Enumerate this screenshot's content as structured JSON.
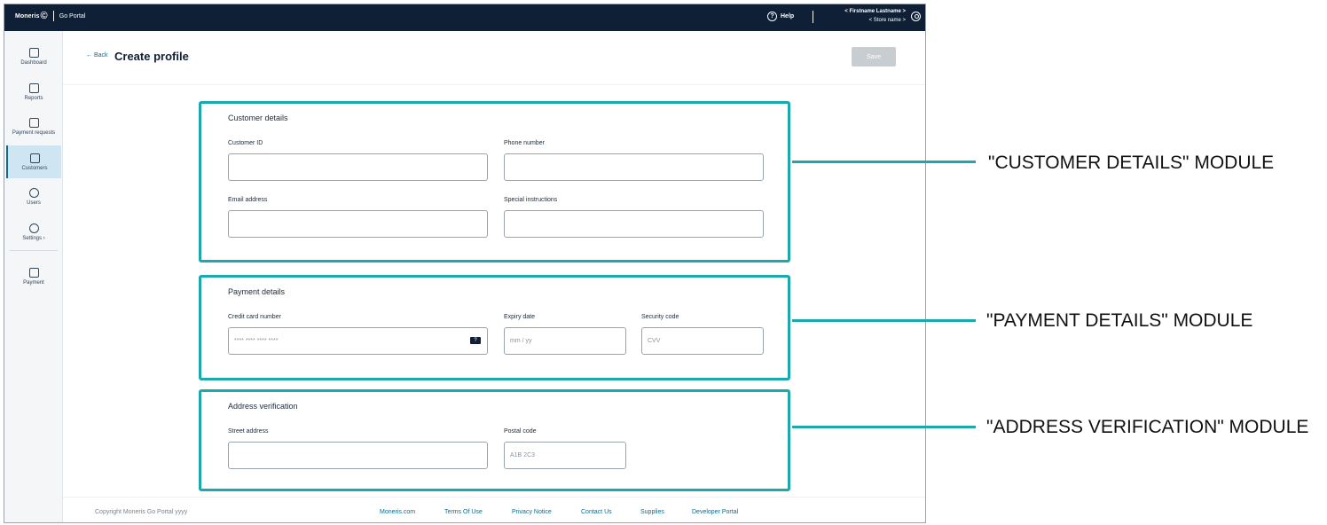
{
  "header": {
    "brand": "Moneris",
    "portal": "Go Portal",
    "help": "Help",
    "user_name": "< Firstname Lastname >",
    "store_name": "< Store name >"
  },
  "sidebar": {
    "items": [
      {
        "label": "Dashboard",
        "icon": "dashboard-icon"
      },
      {
        "label": "Reports",
        "icon": "reports-icon"
      },
      {
        "label": "Payment requests",
        "icon": "payment-requests-icon"
      },
      {
        "label": "Customers",
        "icon": "customers-icon",
        "active": true
      },
      {
        "label": "Users",
        "icon": "users-icon"
      },
      {
        "label": "Settings",
        "icon": "settings-icon"
      },
      {
        "label": "Payment",
        "icon": "payment-icon"
      }
    ]
  },
  "page": {
    "back": "Back",
    "title": "Create profile",
    "save": "Save"
  },
  "customer_details": {
    "title": "Customer details",
    "customer_id": "Customer ID",
    "phone": "Phone number",
    "email": "Email address",
    "instructions": "Special instructions"
  },
  "payment_details": {
    "title": "Payment details",
    "card_label": "Credit card number",
    "card_placeholder": "**** **** **** ****",
    "card_badge": "?",
    "expiry_label": "Expiry date",
    "expiry_placeholder": "mm / yy",
    "cvv_label": "Security code",
    "cvv_placeholder": "CVV"
  },
  "address_verification": {
    "title": "Address verification",
    "street_label": "Street address",
    "postal_label": "Postal code",
    "postal_placeholder": "A1B 2C3"
  },
  "footer": {
    "copyright": "Copyright Moneris Go Portal yyyy",
    "links": [
      "Moneris.com",
      "Terms Of Use",
      "Privacy Notice",
      "Contact Us",
      "Supplies",
      "Developer Portal"
    ]
  },
  "annotations": {
    "customer": "\"CUSTOMER DETAILS\" MODULE",
    "payment": "\"PAYMENT DETAILS\" MODULE",
    "address": "\"ADDRESS VERIFICATION\" MODULE"
  },
  "colors": {
    "header_bg": "#0e1f36",
    "accent_teal": "#1aa9ad",
    "link_blue": "#0b6d8e",
    "save_disabled": "#c8cdd2"
  }
}
